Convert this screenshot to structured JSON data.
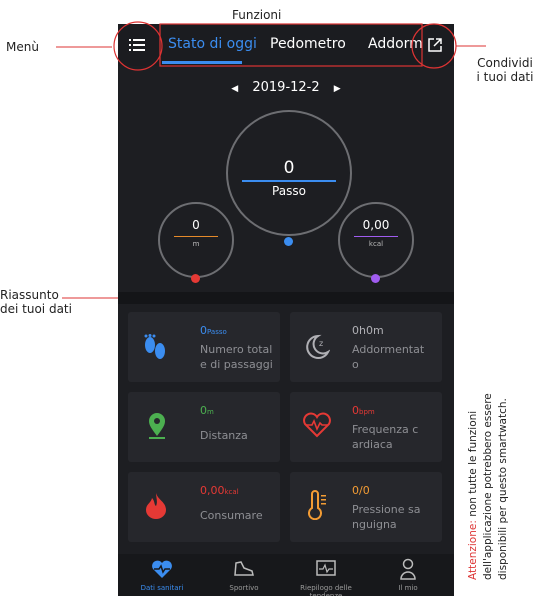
{
  "annotations": {
    "functions": "Funzioni",
    "menu": "Menù",
    "share_line1": "Condividi",
    "share_line2": "i tuoi dati",
    "summary_line1": "Riassunto",
    "summary_line2": "dei tuoi dati",
    "warning_highlight": "Attenzione:",
    "warning_text": "non tutte le funzioni dell'applicazione potrebbero essere disponibili per questo smartwatch."
  },
  "tabs": [
    "Stato di oggi",
    "Pedometro",
    "Addorme"
  ],
  "date": "2019-12-2",
  "steps": {
    "value": "0",
    "label": "Passo"
  },
  "distance": {
    "value": "0",
    "unit": "m"
  },
  "calories": {
    "value": "0,00",
    "unit": "kcal"
  },
  "cards": [
    {
      "value": "0",
      "unit": "Passo",
      "label": "Numero total e di passaggi",
      "icon": "footprints-icon",
      "color": "#3b8df0"
    },
    {
      "value": "0h0m",
      "unit": "",
      "label": "Addormentat o",
      "icon": "moon-icon",
      "color": "#b0b0b5"
    },
    {
      "value": "0",
      "unit": "m",
      "label": "Distanza",
      "icon": "location-pin-icon",
      "color": "#4caf50"
    },
    {
      "value": "0",
      "unit": "bpm",
      "label": "Frequenza c ardiaca",
      "icon": "heart-rate-icon",
      "color": "#e53935"
    },
    {
      "value": "0,00",
      "unit": "kcal",
      "label": "Consumare",
      "icon": "flame-icon",
      "color": "#e53935"
    },
    {
      "value": "0/0",
      "unit": "",
      "label": "Pressione sa nguigna",
      "icon": "thermometer-icon",
      "color": "#f39c34"
    }
  ],
  "nav": [
    {
      "label": "Dati sanitari",
      "icon": "heart-health-icon"
    },
    {
      "label": "Sportivo",
      "icon": "running-shoe-icon"
    },
    {
      "label": "Riepilogo delle tendenze",
      "icon": "trend-chart-icon"
    },
    {
      "label": "Il mio",
      "icon": "person-icon"
    }
  ],
  "colors": {
    "accent": "#3b8df0",
    "red": "#e53935",
    "purple": "#a05cf0",
    "green": "#4caf50",
    "orange": "#f39c34"
  }
}
